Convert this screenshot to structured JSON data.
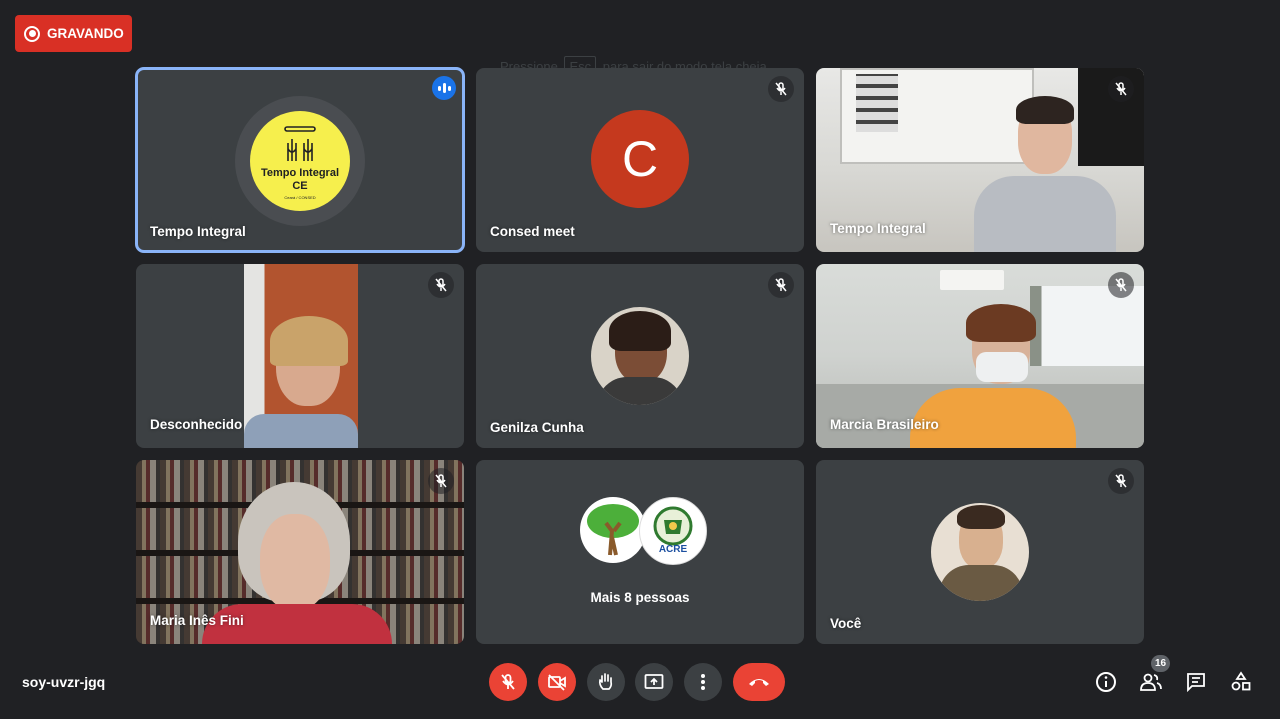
{
  "recording": {
    "label": "GRAVANDO"
  },
  "hint": {
    "prefix": "Pressione",
    "key": "Esc",
    "suffix": "para sair do modo tela cheia"
  },
  "tiles": [
    {
      "name": "Tempo Integral",
      "speaking": true,
      "logo": {
        "line1": "Tempo Integral",
        "line2": "CE",
        "small": "Ceará / CONSED"
      }
    },
    {
      "name": "Consed meet",
      "initial": "C"
    },
    {
      "name": "Tempo Integral"
    },
    {
      "name": "Desconhecido"
    },
    {
      "name": "Genilza Cunha"
    },
    {
      "name": "Marcia Brasileiro"
    },
    {
      "name": "Maria Inês Fini"
    },
    {
      "name": "Mais 8 pessoas",
      "logo_text": "ACRE"
    },
    {
      "name": "Você"
    }
  ],
  "meeting": {
    "code": "soy-uvzr-jgq",
    "participants": "16"
  },
  "colors": {
    "background": "#202124",
    "tile": "#3c4043",
    "red": "#ea4335",
    "accent": "#1a73e8",
    "active_border": "#8ab4f8"
  },
  "icons": [
    "record-icon",
    "mic-off-icon",
    "speaking-icon",
    "video-off-icon",
    "raise-hand-icon",
    "present-icon",
    "more-icon",
    "end-call-icon",
    "info-icon",
    "people-icon",
    "chat-icon",
    "activities-icon"
  ]
}
